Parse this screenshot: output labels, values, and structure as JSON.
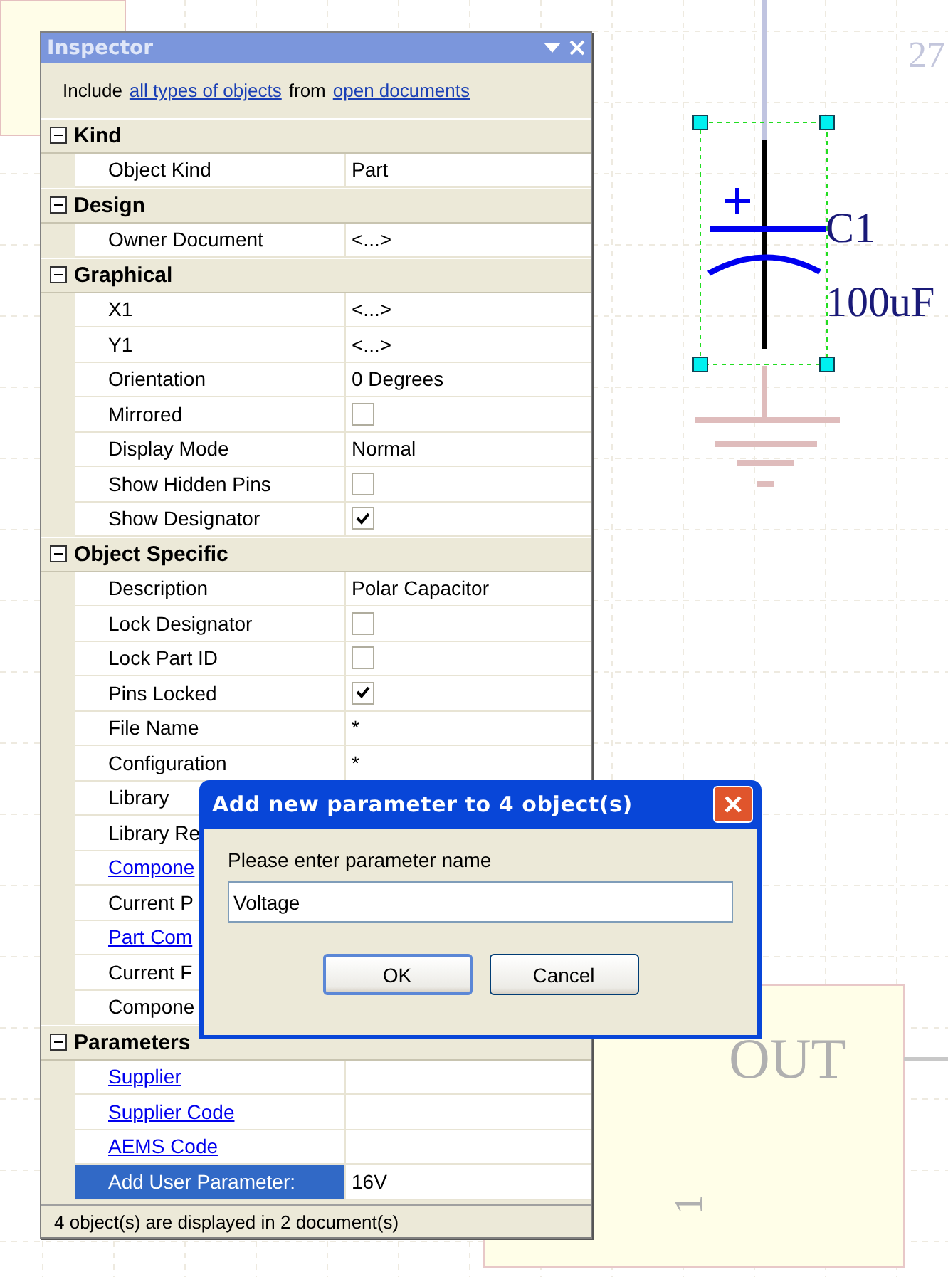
{
  "canvas": {
    "labels": [
      {
        "kind": "sheet-number",
        "text": "27"
      },
      {
        "kind": "designator",
        "text": "C1"
      },
      {
        "kind": "value",
        "text": "100uF"
      },
      {
        "kind": "port",
        "text": "OUT"
      },
      {
        "kind": "pin",
        "text": "1"
      }
    ]
  },
  "inspector": {
    "title": "Inspector",
    "include": {
      "prefix": "Include",
      "scope_link": "all types of objects",
      "middle": "from",
      "source_link": "open documents"
    },
    "sections": [
      {
        "title": "Kind",
        "expanded": true,
        "rows": [
          {
            "kind": "text",
            "name": "Object Kind",
            "value": "Part",
            "selected": false
          }
        ]
      },
      {
        "title": "Design",
        "expanded": true,
        "rows": [
          {
            "kind": "text",
            "name": "Owner Document",
            "value": "<...>",
            "selected": false
          }
        ]
      },
      {
        "title": "Graphical",
        "expanded": true,
        "rows": [
          {
            "kind": "text",
            "name": "X1",
            "value": "<...>",
            "selected": false
          },
          {
            "kind": "text",
            "name": "Y1",
            "value": "<...>",
            "selected": false
          },
          {
            "kind": "text",
            "name": "Orientation",
            "value": "0 Degrees",
            "selected": false
          },
          {
            "kind": "check",
            "name": "Mirrored",
            "checked": false,
            "selected": false
          },
          {
            "kind": "text",
            "name": "Display Mode",
            "value": "Normal",
            "selected": false
          },
          {
            "kind": "check",
            "name": "Show Hidden Pins",
            "checked": false,
            "selected": false
          },
          {
            "kind": "check",
            "name": "Show Designator",
            "checked": true,
            "selected": false
          }
        ]
      },
      {
        "title": "Object Specific",
        "expanded": true,
        "rows": [
          {
            "kind": "text",
            "name": "Description",
            "value": "Polar Capacitor",
            "selected": false
          },
          {
            "kind": "check",
            "name": "Lock Designator",
            "checked": false,
            "selected": false
          },
          {
            "kind": "check",
            "name": "Lock Part ID",
            "checked": false,
            "selected": false
          },
          {
            "kind": "check",
            "name": "Pins Locked",
            "checked": true,
            "selected": false
          },
          {
            "kind": "text",
            "name": "File Name",
            "value": "*",
            "selected": false
          },
          {
            "kind": "text",
            "name": "Configuration",
            "value": "*",
            "selected": false
          },
          {
            "kind": "text",
            "name": "Library",
            "selected": false
          },
          {
            "kind": "text",
            "name": "Library Re",
            "selected": false
          },
          {
            "kind": "link",
            "name": "Compone",
            "selected": false
          },
          {
            "kind": "text",
            "name": "Current P",
            "selected": false
          },
          {
            "kind": "link",
            "name": "Part Com",
            "selected": false
          },
          {
            "kind": "text",
            "name": "Current F",
            "selected": false
          },
          {
            "kind": "text",
            "name": "Compone",
            "selected": false
          }
        ]
      },
      {
        "title": "Parameters",
        "expanded": true,
        "rows": [
          {
            "kind": "link",
            "name": "Supplier",
            "selected": false
          },
          {
            "kind": "link",
            "name": "Supplier Code",
            "selected": false
          },
          {
            "kind": "link",
            "name": "AEMS Code",
            "selected": false
          },
          {
            "kind": "text",
            "name": "Add User Parameter:",
            "value": "16V",
            "selected": true
          }
        ]
      }
    ],
    "status_bar": "4 object(s) are displayed in 2 document(s)"
  },
  "dialog": {
    "title": "Add new parameter to 4 object(s)",
    "prompt": "Please enter parameter name",
    "value": "Voltage",
    "buttons": [
      {
        "label": "OK",
        "default": true
      },
      {
        "label": "Cancel",
        "default": false
      }
    ]
  }
}
